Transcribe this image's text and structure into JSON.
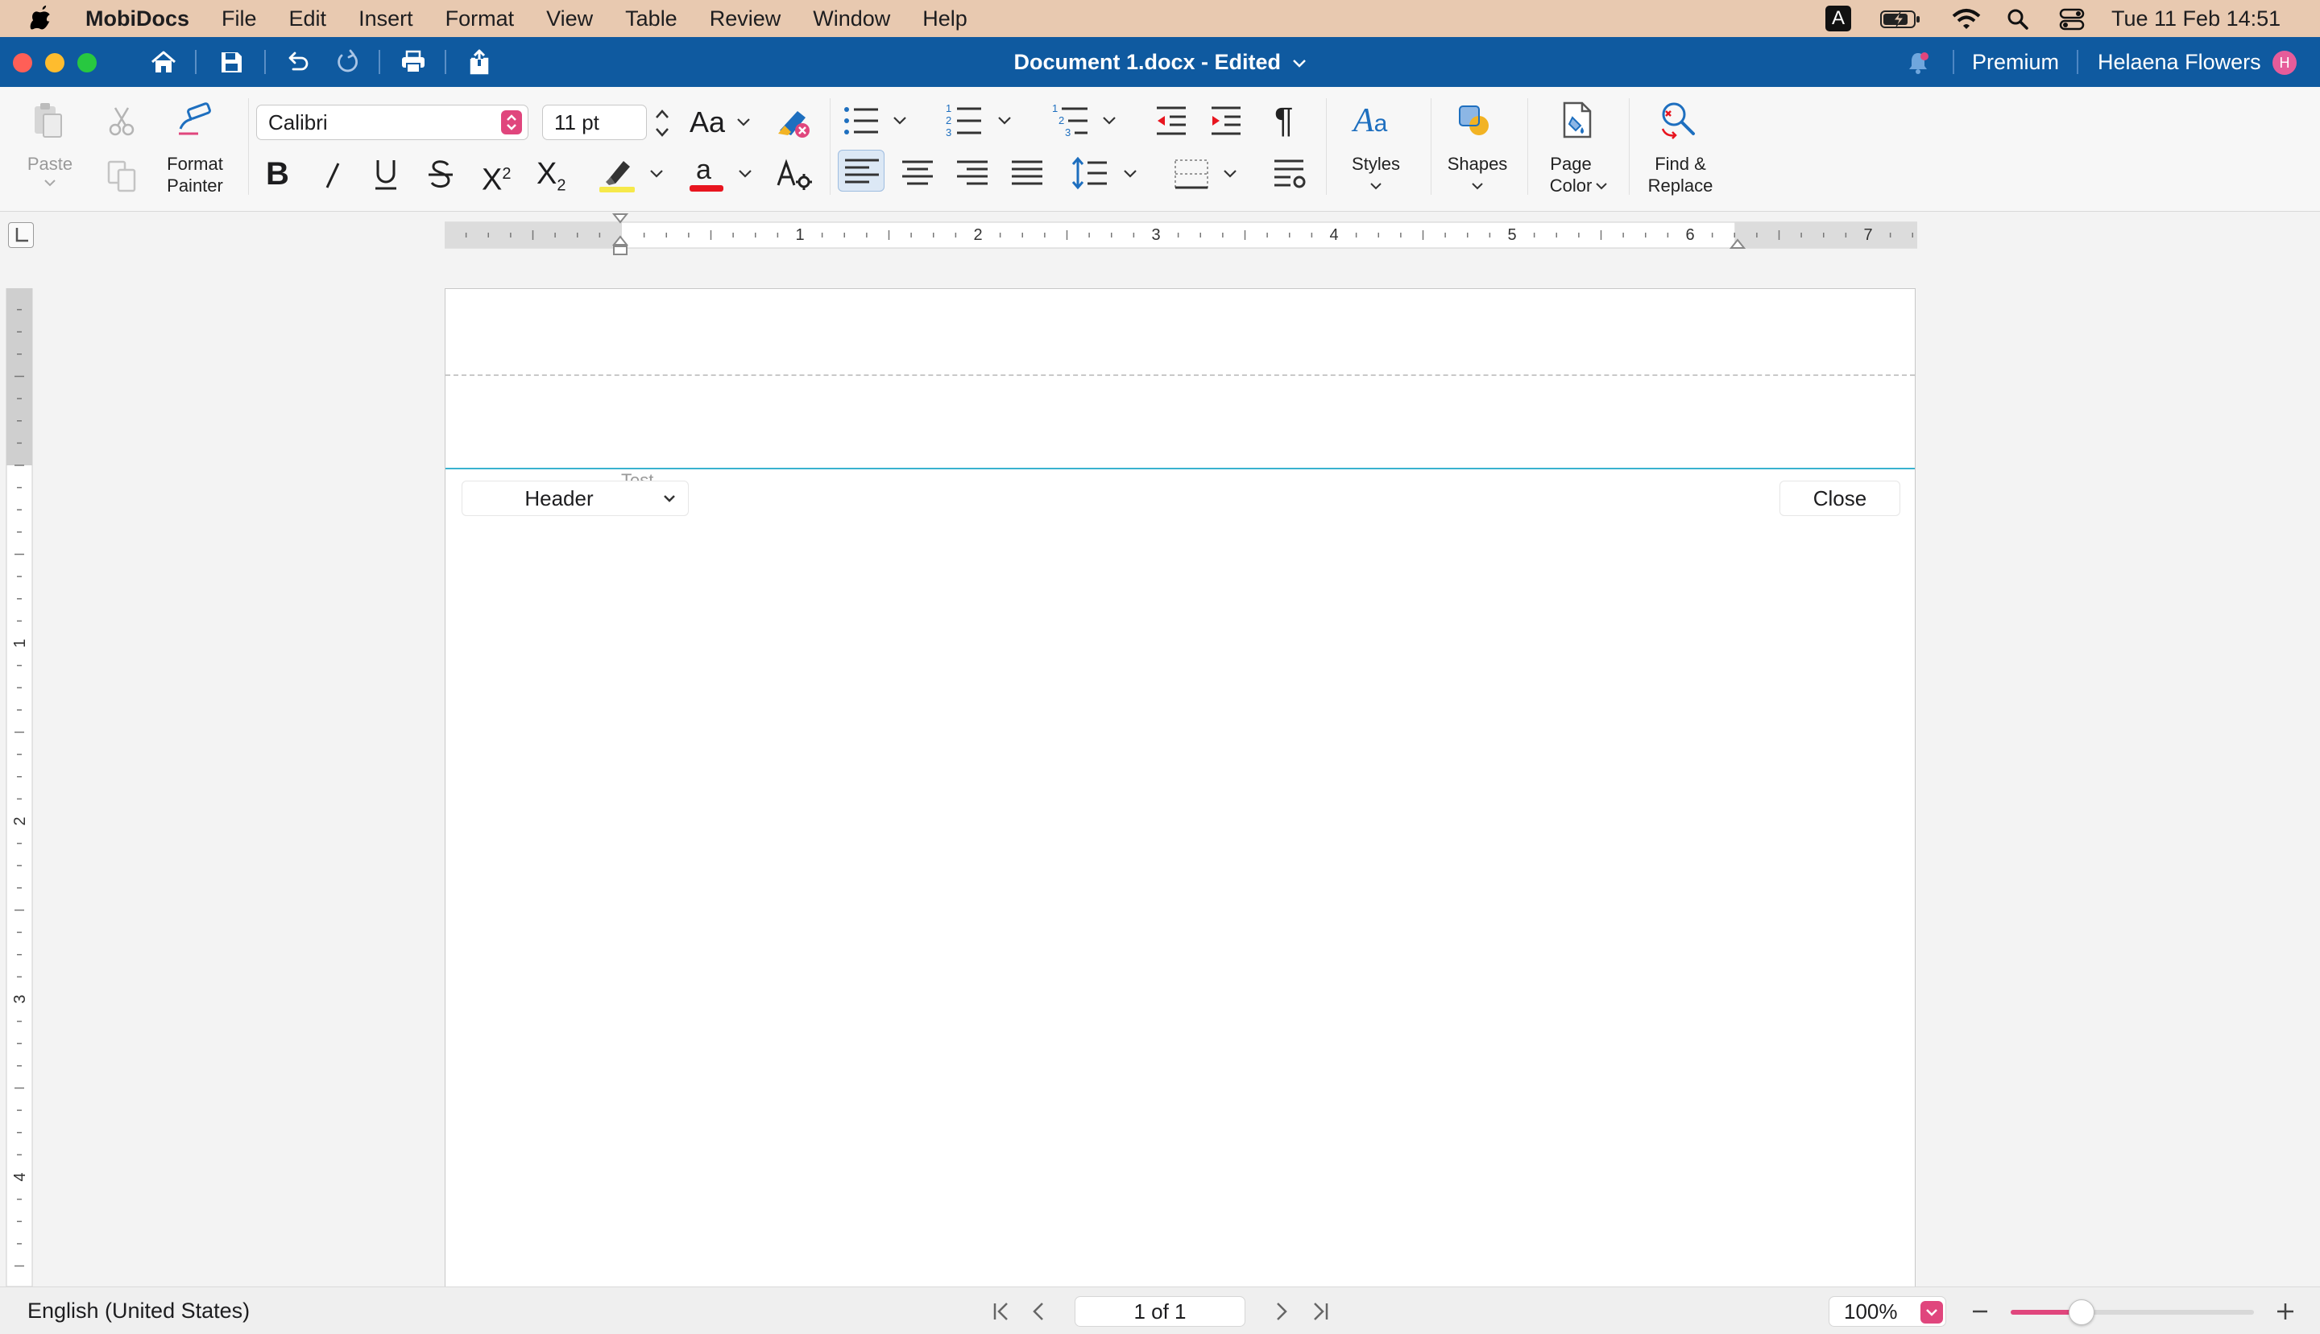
{
  "menubar": {
    "app_name": "MobiDocs",
    "menus": [
      "File",
      "Edit",
      "Insert",
      "Format",
      "View",
      "Table",
      "Review",
      "Window",
      "Help"
    ],
    "input_source": "A",
    "clock": "Tue 11 Feb  14:51"
  },
  "titlebar": {
    "doc_title": "Document 1.docx - Edited",
    "premium_label": "Premium",
    "user_name": "Helaena Flowers",
    "avatar_initial": "H"
  },
  "ribbon": {
    "paste_label": "Paste",
    "format_painter_label": [
      "Format",
      "Painter"
    ],
    "font_name": "Calibri",
    "font_size": "11 pt",
    "change_case_label": "Aa",
    "styles_label": "Styles",
    "shapes_label": "Shapes",
    "page_color_label": [
      "Page",
      "Color"
    ],
    "find_replace_label": [
      "Find &",
      "Replace"
    ],
    "accent_color": "#e0467d"
  },
  "ruler": {
    "horizontal_numbers": [
      "1",
      "2",
      "3",
      "4",
      "5",
      "6",
      "7"
    ],
    "vertical_numbers": [
      "1",
      "2",
      "3",
      "4"
    ]
  },
  "document": {
    "ghost_text": "Test",
    "header_dropdown": "Header",
    "close_label": "Close"
  },
  "statusbar": {
    "language": "English (United States)",
    "page_indicator": "1 of 1",
    "zoom": "100%",
    "zoom_slider_fraction": 0.29
  }
}
